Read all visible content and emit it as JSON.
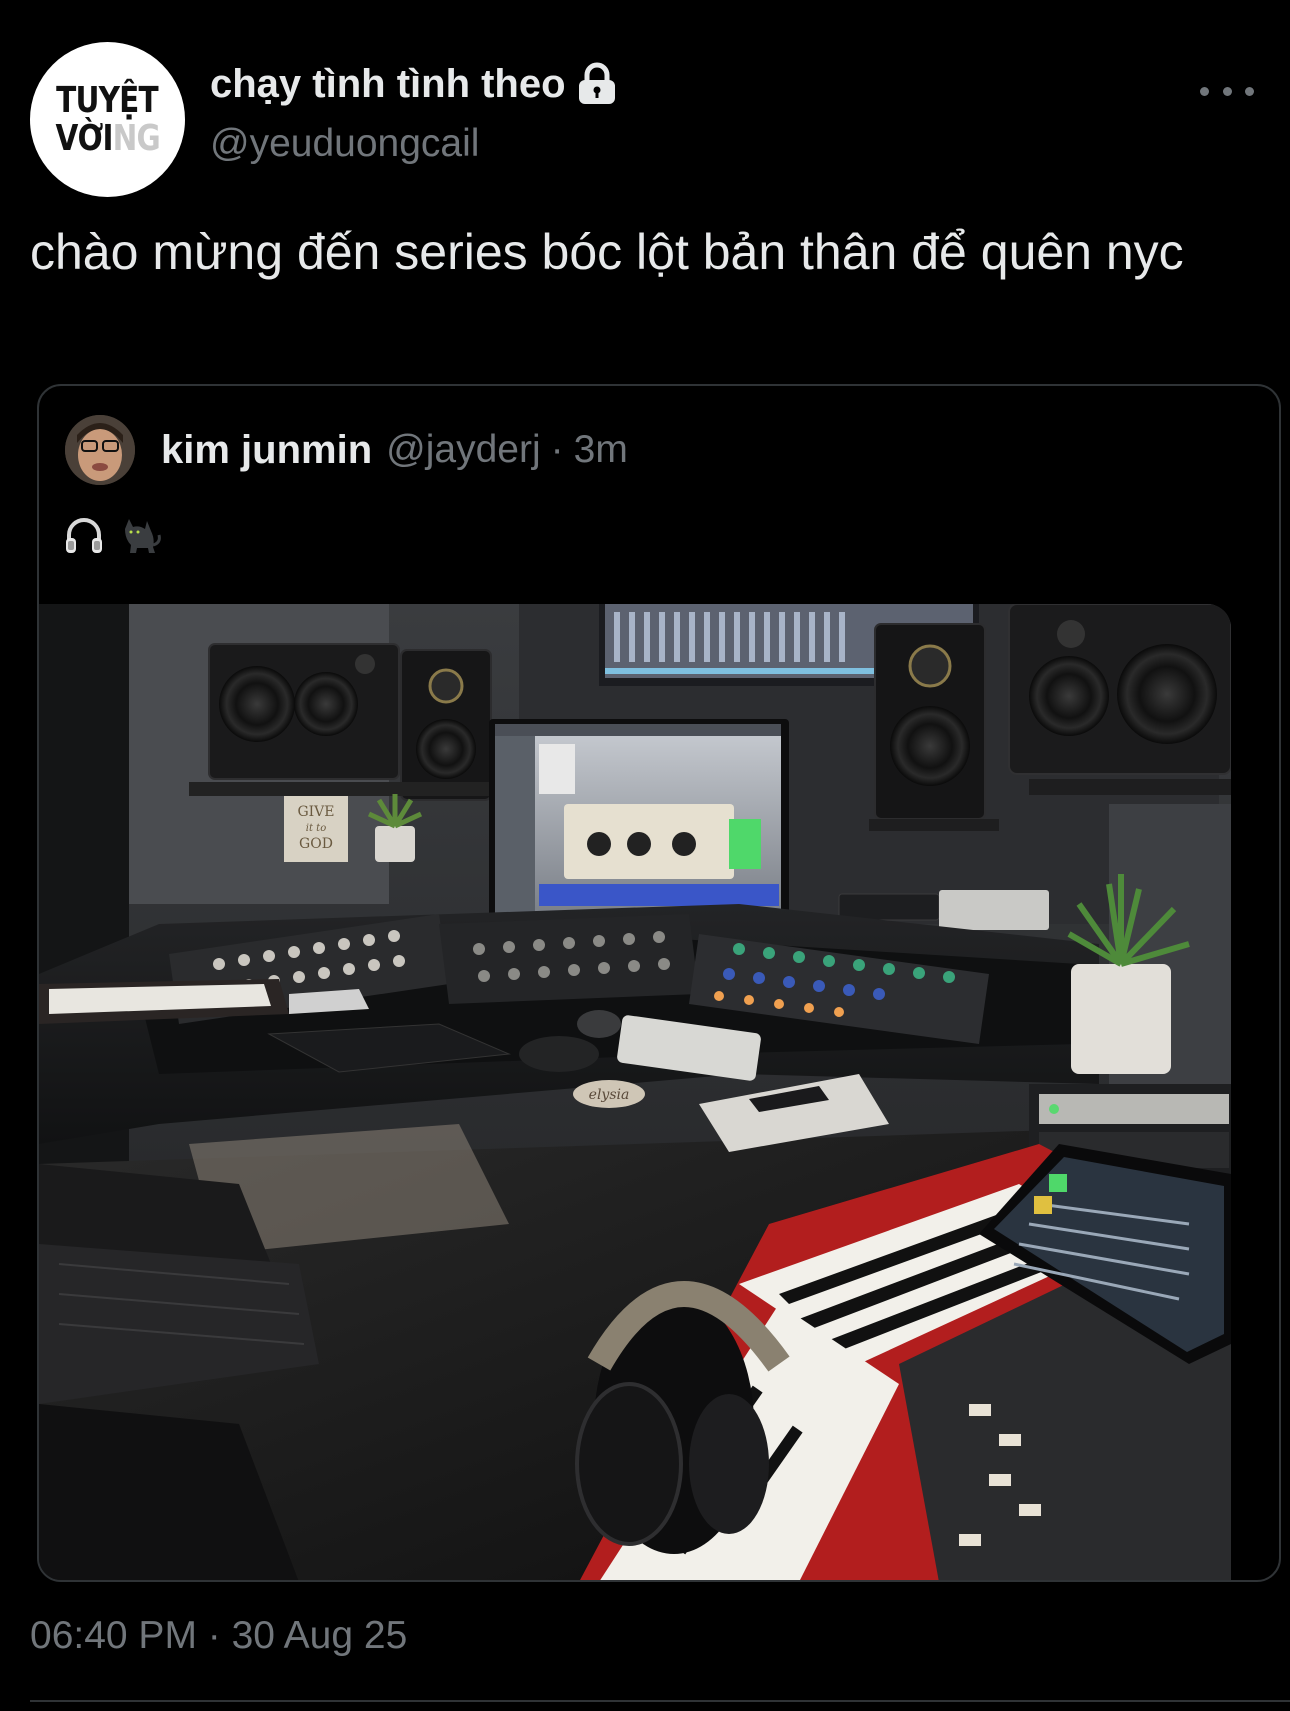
{
  "tweet": {
    "author": {
      "avatar_text_line1": "TUYỆT",
      "avatar_text_line2_dark": "VỜI",
      "avatar_text_line2_light": "NG",
      "display_name": "chạy tình tình theo",
      "handle": "@yeuduongcail",
      "protected_icon": "lock-icon"
    },
    "more_icon": "more-horizontal-icon",
    "text": "chào mừng đến series bóc lột bản thân để quên nyc",
    "timestamp": "06:40 PM · 30 Aug 25"
  },
  "quote": {
    "display_name": "kim junmin",
    "handle": "@jayderj",
    "separator": "·",
    "time": "3m",
    "emojis": [
      "headphones-icon",
      "black-cat-icon"
    ],
    "media": {
      "alt_scene": "music-studio-photo",
      "sign_text": [
        "GIVE",
        "it to",
        "GOD"
      ],
      "coaster_text": "elysia"
    }
  },
  "colors": {
    "background": "#000000",
    "primary_text": "#e7e9ea",
    "secondary_text": "#71767b",
    "border": "#2f3336"
  }
}
